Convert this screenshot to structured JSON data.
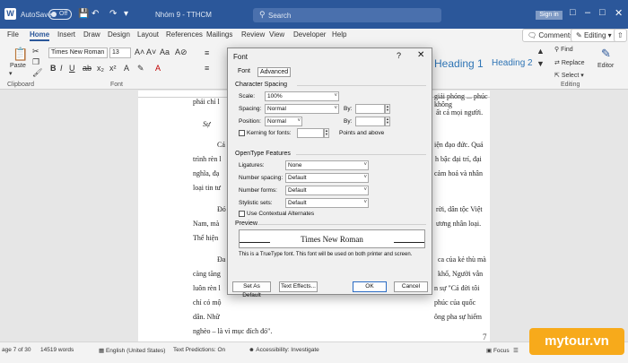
{
  "titlebar": {
    "autosave_label": "AutoSave",
    "autosave_state": "Off",
    "doc_title": "Nhóm 9 - TTHCM",
    "search_placeholder": "Search",
    "signin": "Sign in",
    "logo": "W"
  },
  "tabs": [
    "File",
    "Home",
    "Insert",
    "Draw",
    "Design",
    "Layout",
    "References",
    "Mailings",
    "Review",
    "View",
    "Developer",
    "Help"
  ],
  "ribbon_right": {
    "comments": "Comments",
    "editing": "Editing"
  },
  "ribbon": {
    "paste": "Paste",
    "font_name": "Times New Roman",
    "font_size": "13",
    "groups": {
      "clipboard": "Clipboard",
      "font": "Font",
      "editing": "Editing"
    },
    "heading1": "Heading 1",
    "heading2": "Heading 2",
    "find": "Find",
    "replace": "Replace",
    "select": "Select",
    "editor": "Editor"
  },
  "document": {
    "lines_left": [
      "phải chỉ l",
      "Sự",
      "Cá",
      "trình rèn l",
      "nghĩa, đạ",
      "loại tin tư",
      "Đó",
      "Nam, mà",
      "Thể hiện",
      "Đa",
      "càng tăng",
      "luôn rèn l",
      "chỉ có mộ",
      "dân. Nhữ",
      "nghèo – là vì mục đích đó\"."
    ],
    "lines_right": [
      "giải phóng ... phúc không",
      "ất cả mọi người.",
      "iện đạo đức. Quá",
      "h bậc đại trí, đại",
      "cảm hoá và nhân",
      "rời, dân tộc Việt",
      "ương nhân loại.",
      "ca của kẻ thù mà",
      "khổ, Người vẫn",
      "n sự \"Cả đời tôi",
      "phúc của quốc",
      "ông pha sự hiểm"
    ],
    "page_number": "7"
  },
  "status": {
    "page": "age 7 of 30",
    "words": "14519 words",
    "language": "English (United States)",
    "predictions": "Text Predictions: On",
    "accessibility": "Accessibility: Investigate",
    "focus": "Focus"
  },
  "dialog": {
    "title": "Font",
    "help": "?",
    "tabs": [
      "Font",
      "Advanced"
    ],
    "char_spacing": {
      "header": "Character Spacing",
      "scale_label": "Scale:",
      "scale_value": "100%",
      "spacing_label": "Spacing:",
      "spacing_value": "Normal",
      "position_label": "Position:",
      "position_value": "Normal",
      "by_label": "By:",
      "kerning_label": "Kerning for fonts:",
      "points_label": "Points and above"
    },
    "opentype": {
      "header": "OpenType Features",
      "ligatures_label": "Ligatures:",
      "ligatures_value": "None",
      "number_spacing_label": "Number spacing:",
      "number_spacing_value": "Default",
      "number_forms_label": "Number forms:",
      "number_forms_value": "Default",
      "stylistic_label": "Stylistic sets:",
      "stylistic_value": "Default",
      "contextual_label": "Use Contextual Alternates"
    },
    "preview": {
      "header": "Preview",
      "text": "Times New Roman",
      "note": "This is a TrueType font. This font will be used on both printer and screen."
    },
    "buttons": {
      "default": "Set As Default",
      "effects": "Text Effects...",
      "ok": "OK",
      "cancel": "Cancel"
    }
  },
  "brand": "mytour.vn"
}
